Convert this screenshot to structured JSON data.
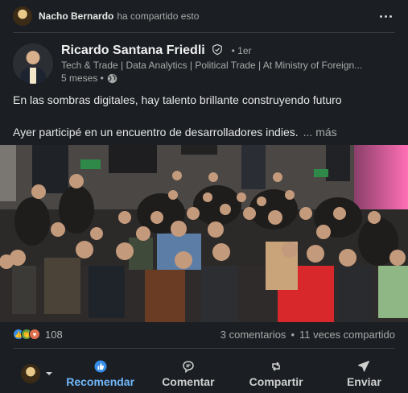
{
  "shared_by": {
    "name": "Nacho Bernardo",
    "action_text": "ha compartido esto"
  },
  "author": {
    "name": "Ricardo Santana Friedli",
    "degree": "• 1er",
    "headline": "Tech & Trade | Data Analytics | Political Trade | At Ministry of Foreign...",
    "time": "5 meses •"
  },
  "post": {
    "line1": "En las sombras digitales, hay talento brillante construyendo futuro",
    "line2": "Ayer participé en un encuentro de desarrolladores indies.",
    "see_more": "... más"
  },
  "social": {
    "reaction_count": "108",
    "comments": "3 comentarios",
    "separator": "•",
    "shares": "11 veces compartido"
  },
  "actions": {
    "like": "Recomendar",
    "comment": "Comentar",
    "share": "Compartir",
    "send": "Enviar"
  },
  "colors": {
    "background": "#1b1f23",
    "accent": "#71b7fb",
    "muted_text": "#a8a8a8"
  },
  "icons": [
    "more-options-icon",
    "verified-icon",
    "globe-icon",
    "like-icon",
    "comment-icon",
    "repost-icon",
    "send-icon",
    "chevron-down-icon"
  ]
}
